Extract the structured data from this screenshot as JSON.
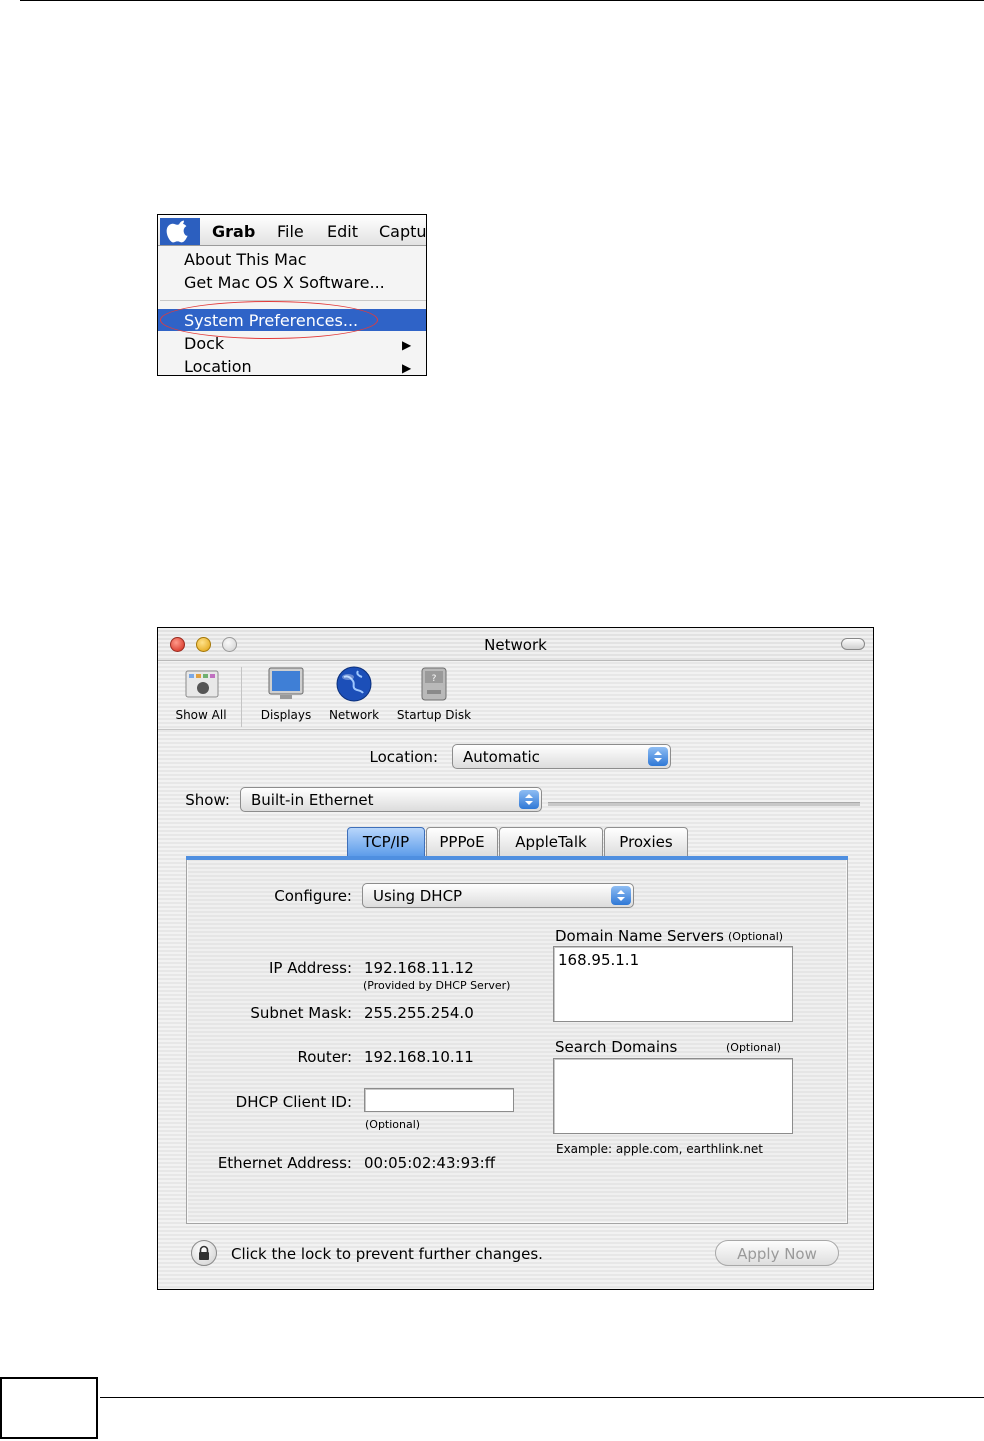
{
  "menu_screenshot": {
    "menubar": [
      "Grab",
      "File",
      "Edit",
      "Captu"
    ],
    "items": [
      {
        "label": "About This Mac"
      },
      {
        "label": "Get Mac OS X Software..."
      },
      {
        "label": "System Preferences...",
        "highlighted": true
      },
      {
        "label": "Dock",
        "submenu": true
      },
      {
        "label": "Location",
        "submenu": true
      }
    ],
    "arrow_glyph": "▶",
    "highlight_color": "#2f63c7",
    "annotation_color": "#e23b3b"
  },
  "network_window": {
    "title": "Network",
    "toolbar": [
      {
        "label": "Show All",
        "icon": "show-all-icon"
      },
      {
        "label": "Displays",
        "icon": "displays-icon"
      },
      {
        "label": "Network",
        "icon": "network-globe-icon"
      },
      {
        "label": "Startup Disk",
        "icon": "startup-disk-icon"
      }
    ],
    "location": {
      "label": "Location:",
      "value": "Automatic"
    },
    "show": {
      "label": "Show:",
      "value": "Built-in Ethernet"
    },
    "tabs": [
      {
        "label": "TCP/IP",
        "selected": true
      },
      {
        "label": "PPPoE"
      },
      {
        "label": "AppleTalk"
      },
      {
        "label": "Proxies"
      }
    ],
    "configure": {
      "label": "Configure:",
      "value": "Using DHCP"
    },
    "ip_address": {
      "label": "IP Address:",
      "value": "192.168.11.12",
      "note": "(Provided by DHCP Server)"
    },
    "subnet_mask": {
      "label": "Subnet Mask:",
      "value": "255.255.254.0"
    },
    "router": {
      "label": "Router:",
      "value": "192.168.10.11"
    },
    "dhcp_client_id": {
      "label": "DHCP Client ID:",
      "value": "",
      "note": "(Optional)"
    },
    "ethernet_address": {
      "label": "Ethernet Address:",
      "value": "00:05:02:43:93:ff"
    },
    "dns": {
      "label": "Domain Name Servers",
      "optional": "(Optional)",
      "value": "168.95.1.1"
    },
    "search_domains": {
      "label": "Search Domains",
      "optional": "(Optional)",
      "value": "",
      "example": "Example: apple.com, earthlink.net"
    },
    "lock_text": "Click the lock to prevent further changes.",
    "apply_button": "Apply Now",
    "accent_color": "#4f8fe0"
  }
}
